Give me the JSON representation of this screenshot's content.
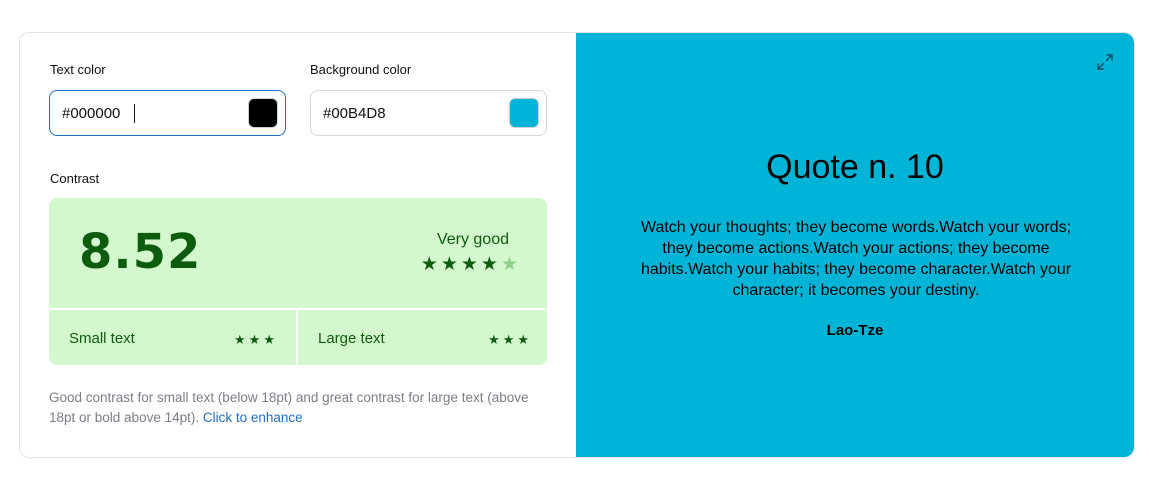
{
  "colors": {
    "text_color_label": "Text color",
    "text_color_value": "#000000",
    "text_color_swatch": "#000000",
    "background_color_label": "Background color",
    "background_color_value": "#00B4D8",
    "background_color_swatch": "#00B4D8"
  },
  "contrast": {
    "label": "Contrast",
    "score": "8.52",
    "rating": "Very good",
    "rating_stars": 4,
    "rating_stars_max": 5,
    "small_text_label": "Small text",
    "small_text_stars": 3,
    "large_text_label": "Large text",
    "large_text_stars": 3,
    "accent": "#0d5c0d",
    "box_color": "#d4f8ce"
  },
  "description": {
    "text": "Good contrast for small text (below 18pt) and great contrast for large text (above 18pt or bold above 14pt).",
    "link": "Click to enhance"
  },
  "preview": {
    "title": "Quote n. 10",
    "body": "Watch your thoughts; they become words.Watch your words; they become actions.Watch your actions; they become habits.Watch your habits; they become character.Watch your character; it becomes your destiny.",
    "author": "Lao-Tze",
    "expand_icon": "expand-icon"
  }
}
